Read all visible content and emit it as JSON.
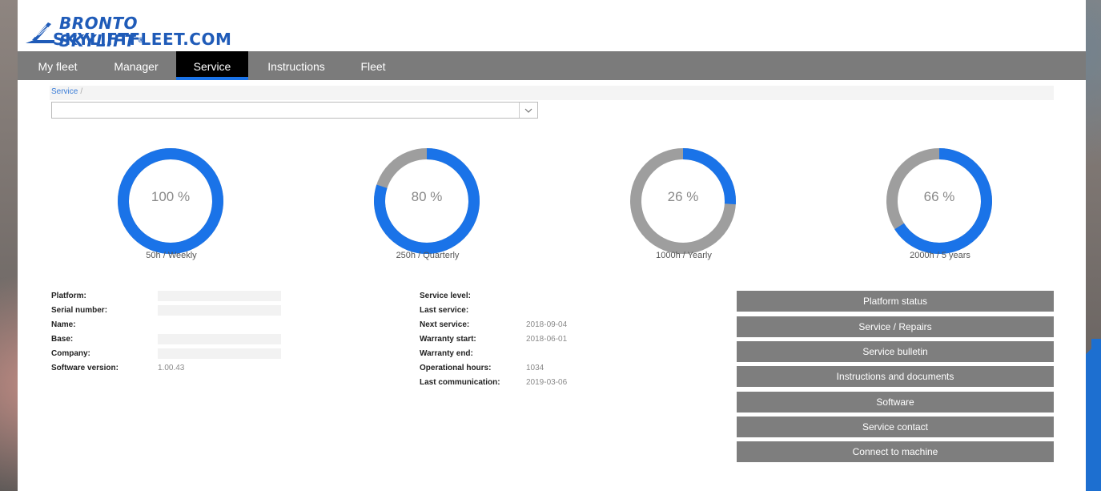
{
  "brand": {
    "line1": "BRONTO SKYLIFT",
    "registered": "®",
    "line2": "SKYLIFTFLEET.COM",
    "color": "#1f5bb8"
  },
  "header_icons": [
    "mail-icon",
    "user-icon"
  ],
  "nav": {
    "tabs": [
      {
        "label": "My fleet",
        "active": false
      },
      {
        "label": "Manager",
        "active": false
      },
      {
        "label": "Service",
        "active": true
      },
      {
        "label": "Instructions",
        "active": false
      },
      {
        "label": "Fleet",
        "active": false
      }
    ],
    "active_color": "#000000",
    "accent_color": "#1a73e8"
  },
  "breadcrumb": {
    "item": "Service",
    "separator": "/"
  },
  "machine_select": {
    "value": ""
  },
  "gauges": [
    {
      "percent": 100,
      "value_text": "100 %",
      "label": "50h / Weekly"
    },
    {
      "percent": 80,
      "value_text": "80 %",
      "label": "250h / Quarterly"
    },
    {
      "percent": 26,
      "value_text": "26 %",
      "label": "1000h / Yearly"
    },
    {
      "percent": 66,
      "value_text": "66 %",
      "label": "2000h / 5 years"
    }
  ],
  "gauge_colors": {
    "progress": "#1a73e8",
    "track": "#9e9e9e"
  },
  "machine_info": [
    {
      "label": "Platform:",
      "value": ""
    },
    {
      "label": "Serial number:",
      "value": ""
    },
    {
      "label": "Name:",
      "value": ""
    },
    {
      "label": "Base:",
      "value": ""
    },
    {
      "label": "Company:",
      "value": ""
    },
    {
      "label": "Software version:",
      "value": "1.00.43"
    }
  ],
  "service_info": [
    {
      "label": "Service level:",
      "value": ""
    },
    {
      "label": "Last service:",
      "value": ""
    },
    {
      "label": "Next service:",
      "value": "2018-09-04"
    },
    {
      "label": "Warranty start:",
      "value": "2018-06-01"
    },
    {
      "label": "Warranty end:",
      "value": ""
    },
    {
      "label": "Operational hours:",
      "value": "1034"
    },
    {
      "label": "Last communication:",
      "value": "2019-03-06"
    }
  ],
  "actions": [
    "Platform status",
    "Service / Repairs",
    "Service bulletin",
    "Instructions and documents",
    "Software",
    "Service contact",
    "Connect to machine"
  ]
}
